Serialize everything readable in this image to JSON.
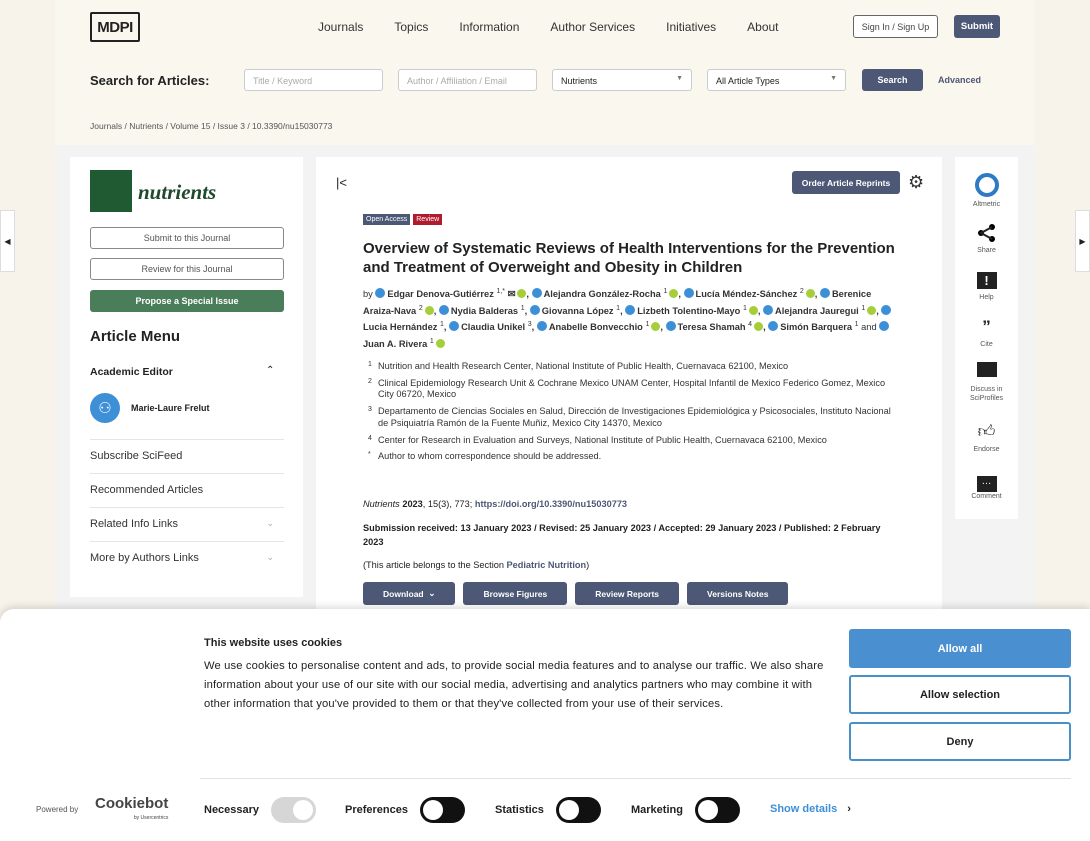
{
  "header": {
    "logo": "MDPI",
    "nav": [
      "Journals",
      "Topics",
      "Information",
      "Author Services",
      "Initiatives",
      "About"
    ],
    "sign_in": "Sign In / Sign Up",
    "submit": "Submit"
  },
  "search": {
    "label": "Search for Articles:",
    "title_placeholder": "Title / Keyword",
    "author_placeholder": "Author / Affiliation / Email",
    "journal": "Nutrients",
    "article_type": "All Article Types",
    "search": "Search",
    "advanced": "Advanced"
  },
  "breadcrumb": "Journals / Nutrients / Volume 15 / Issue 3 / 10.3390/nu15030773",
  "left": {
    "journal": "nutrients",
    "submit": "Submit to this Journal",
    "review": "Review for this Journal",
    "propose": "Propose a Special Issue",
    "menu_title": "Article Menu",
    "academic_editor": "Academic Editor",
    "editor_name": "Marie-Laure Frelut",
    "links": [
      "Subscribe SciFeed",
      "Recommended Articles",
      "Related Info Links",
      "More by Authors Links"
    ]
  },
  "article": {
    "order_reprints": "Order Article Reprints",
    "badges": [
      {
        "label": "Open Access",
        "color": "#4d5876"
      },
      {
        "label": "Review",
        "color": "#b01c2e"
      }
    ],
    "title": "Overview of Systematic Reviews of Health Interventions for the Prevention and Treatment of Overweight and Obesity in Children",
    "by": "by",
    "authors": [
      {
        "name": "Edgar Denova-Gutiérrez",
        "sup": "1,*",
        "email": true,
        "orcid": true
      },
      {
        "name": "Alejandra González-Rocha",
        "sup": "1",
        "orcid": true
      },
      {
        "name": "Lucía Méndez-Sánchez",
        "sup": "2",
        "orcid": true
      },
      {
        "name": "Berenice Araiza-Nava",
        "sup": "2",
        "orcid": true
      },
      {
        "name": "Nydia Balderas",
        "sup": "1",
        "orcid": false
      },
      {
        "name": "Giovanna López",
        "sup": "1",
        "orcid": false
      },
      {
        "name": "Lizbeth Tolentino-Mayo",
        "sup": "1",
        "orcid": true
      },
      {
        "name": "Alejandra Jauregui",
        "sup": "1",
        "orcid": true
      },
      {
        "name": "Lucia Hernández",
        "sup": "1",
        "orcid": false
      },
      {
        "name": "Claudia Unikel",
        "sup": "3",
        "orcid": false
      },
      {
        "name": "Anabelle Bonvecchio",
        "sup": "1",
        "orcid": true
      },
      {
        "name": "Teresa Shamah",
        "sup": "4",
        "orcid": true
      },
      {
        "name": "Simón Barquera",
        "sup": "1",
        "orcid": false
      },
      {
        "name": "Juan A. Rivera",
        "sup": "1",
        "orcid": true
      }
    ],
    "and": "and",
    "affiliations": [
      {
        "n": "1",
        "text": "Nutrition and Health Research Center, National Institute of Public Health, Cuernavaca 62100, Mexico"
      },
      {
        "n": "2",
        "text": "Clinical Epidemiology Research Unit & Cochrane Mexico UNAM Center, Hospital Infantil de Mexico Federico Gomez, Mexico City 06720, Mexico"
      },
      {
        "n": "3",
        "text": "Departamento de Ciencias Sociales en Salud, Dirección de Investigaciones Epidemiológica y Psicosociales, Instituto Nacional de Psiquiatría Ramón de la Fuente Muñiz, Mexico City 14370, Mexico"
      },
      {
        "n": "4",
        "text": "Center for Research in Evaluation and Surveys, National Institute of Public Health, Cuernavaca 62100, Mexico"
      },
      {
        "n": "*",
        "text": "Author to whom correspondence should be addressed."
      }
    ],
    "citation": {
      "journal": "Nutrients",
      "year": "2023",
      "rest": ", 15(3), 773; ",
      "doi": "https://doi.org/10.3390/nu15030773"
    },
    "dates": "Submission received: 13 January 2023 / Revised: 25 January 2023 / Accepted: 29 January 2023 / Published: 2 February 2023",
    "section_pre": "(This article belongs to the Section ",
    "section": "Pediatric Nutrition",
    "section_post": ")",
    "buttons": [
      "Download",
      "Browse Figures",
      "Review Reports",
      "Versions Notes"
    ]
  },
  "right": [
    {
      "icon": "altmetric",
      "label": "Altmetric"
    },
    {
      "icon": "share",
      "label": "Share"
    },
    {
      "icon": "help",
      "label": "Help"
    },
    {
      "icon": "quote",
      "label": "Cite"
    },
    {
      "icon": "discuss",
      "label": "Discuss in SciProfiles"
    },
    {
      "icon": "thumbs-up",
      "label": "Endorse"
    },
    {
      "icon": "comment",
      "label": "Comment"
    }
  ],
  "cookie": {
    "title": "This website uses cookies",
    "text": "We use cookies to personalise content and ads, to provide social media features and to analyse our traffic. We also share information about your use of our site with our social media, advertising and analytics partners who may combine it with other information that you've provided to them or that they've collected from your use of their services.",
    "allow_all": "Allow all",
    "allow_selection": "Allow selection",
    "deny": "Deny",
    "powered_by": "Powered by",
    "cookiebot": "Cookiebot",
    "usercentrics": "by Usercentrics",
    "toggles": [
      {
        "label": "Necessary",
        "on": true,
        "disabled": true
      },
      {
        "label": "Preferences",
        "on": false
      },
      {
        "label": "Statistics",
        "on": false
      },
      {
        "label": "Marketing",
        "on": false
      }
    ],
    "show_details": "Show details",
    "accent": "#4a90d0"
  }
}
